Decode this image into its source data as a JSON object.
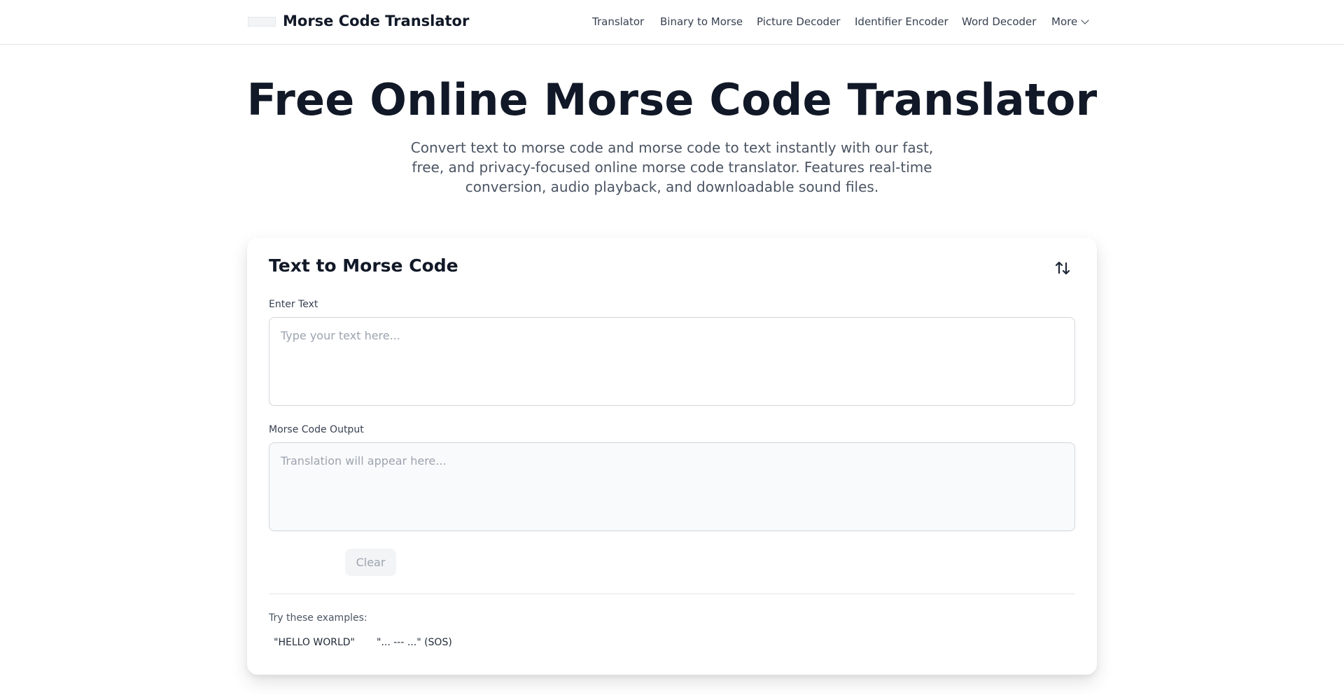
{
  "header": {
    "logo_text": "Morse Code Translator",
    "brand": "Morse Code Translator",
    "nav": [
      "Translator",
      "Binary to Morse",
      "Picture Decoder",
      "Identifier Encoder",
      "Word Decoder"
    ],
    "more_label": "More"
  },
  "hero": {
    "title": "Free Online Morse Code Translator",
    "subtitle": "Convert text to morse code and morse code to text instantly with our fast, free, and privacy-focused online morse code translator. Features real-time conversion, audio playback, and downloadable sound files."
  },
  "card": {
    "title": "Text to Morse Code",
    "swap_icon": "swap-vertical-arrows-icon",
    "input_label": "Enter Text",
    "input_placeholder": "Type your text here...",
    "input_value": "",
    "output_label": "Morse Code Output",
    "output_placeholder": "Translation will appear here...",
    "output_value": "",
    "clear_label": "Clear",
    "examples_label": "Try these examples:",
    "examples": [
      "\"HELLO WORLD\"",
      "\"... --- ...\" (SOS)"
    ]
  }
}
